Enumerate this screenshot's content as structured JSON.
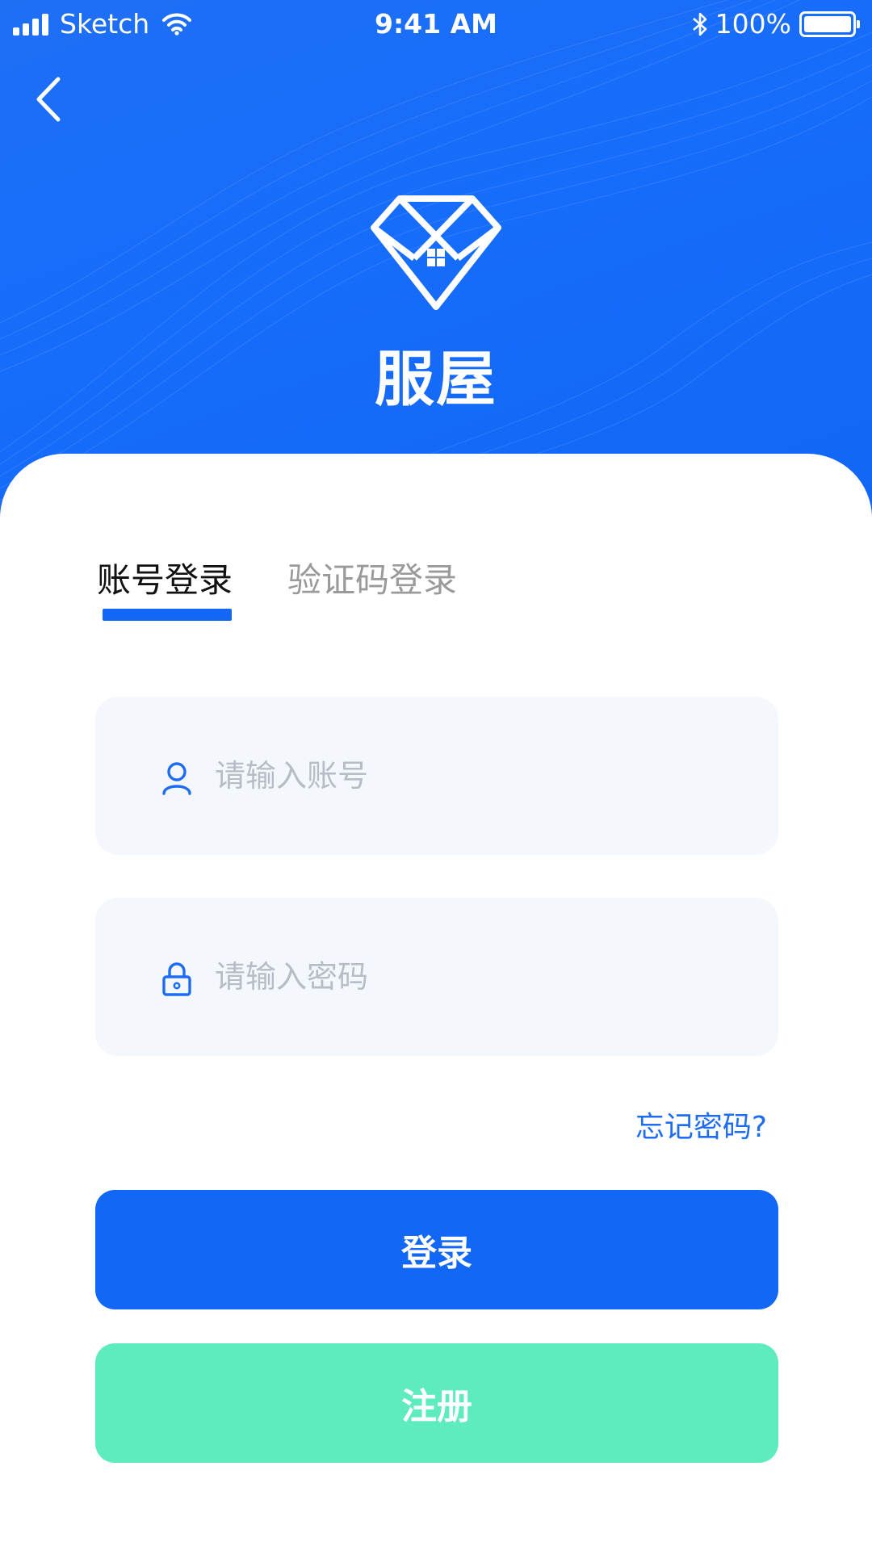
{
  "status_bar": {
    "carrier": "Sketch",
    "time": "9:41 AM",
    "battery": "100%"
  },
  "app": {
    "name": "服屋"
  },
  "tabs": [
    {
      "label": "账号登录",
      "active": true
    },
    {
      "label": "验证码登录",
      "active": false
    }
  ],
  "form": {
    "account_placeholder": "请输入账号",
    "password_placeholder": "请输入密码",
    "forgot_label": "忘记密码?"
  },
  "buttons": {
    "login_label": "登录",
    "register_label": "注册"
  },
  "colors": {
    "primary": "#1267f7",
    "accent_green": "#5eecbf",
    "field_bg": "#f4f8fd"
  },
  "icons": [
    "back-icon",
    "cellular-signal-icon",
    "wifi-icon",
    "bluetooth-icon",
    "battery-icon",
    "user-icon",
    "lock-icon",
    "diamond-house-logo"
  ]
}
